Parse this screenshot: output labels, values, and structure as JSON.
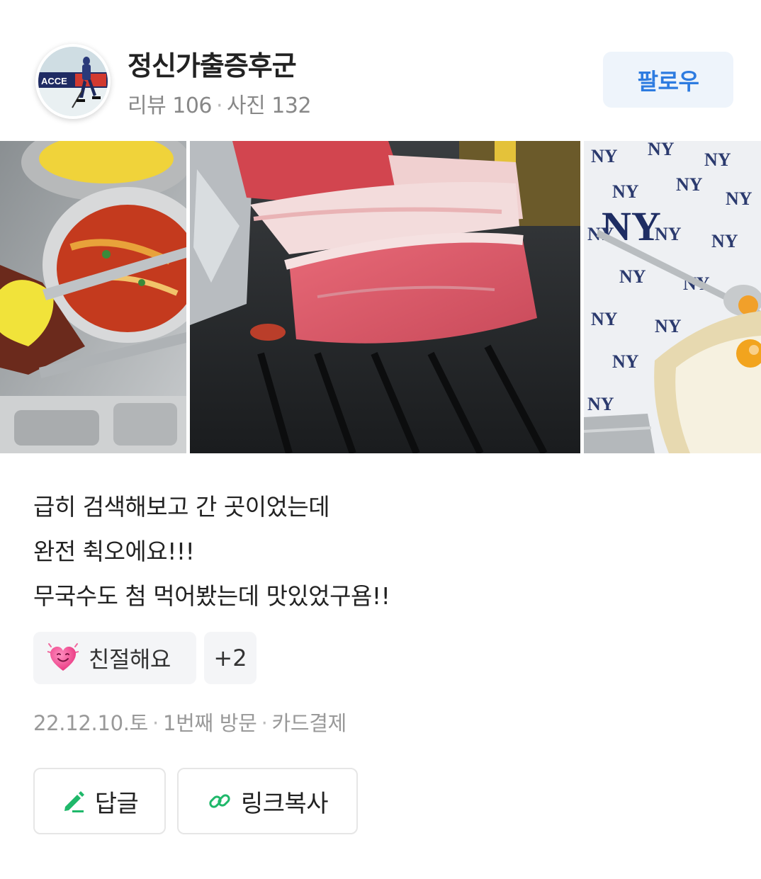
{
  "user": {
    "nickname": "정신가출증후군",
    "review_count_label": "리뷰 106",
    "photo_count_label": "사진 132",
    "separator": "·",
    "follow_label": "팔로우"
  },
  "photos": [
    {
      "alt": "side-dishes-chopsticks"
    },
    {
      "alt": "grilled-pork"
    },
    {
      "alt": "egg-rice-ny-shirt"
    }
  ],
  "review": {
    "lines": [
      "급히 검색해보고 간 곳이었는데",
      "완전 췩오에요!!!",
      "무국수도 첨 먹어봤는데 맛있었구욤!!"
    ]
  },
  "reactions": {
    "main_label": "친절해요",
    "main_icon": "smiling-heart-icon",
    "more_label": "+2"
  },
  "meta": {
    "date": "22.12.10.토",
    "visit": "1번째 방문",
    "payment": "카드결제",
    "separator": "·"
  },
  "actions": {
    "reply_label": "답글",
    "reply_icon": "pencil-icon",
    "link_label": "링크복사",
    "link_icon": "link-icon"
  },
  "colors": {
    "follow_text": "#2d7be0",
    "follow_bg": "#eef4fb",
    "accent_green": "#1fb86a",
    "muted": "#999999"
  }
}
